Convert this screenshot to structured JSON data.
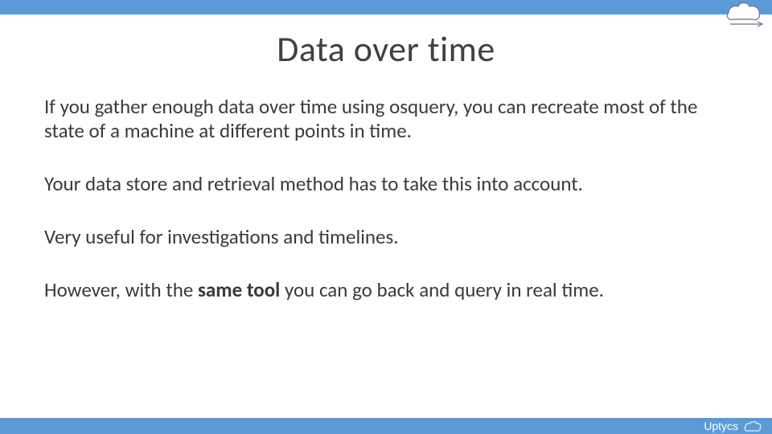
{
  "title": "Data over time",
  "paragraphs": {
    "p1": "If you gather enough data over time using osquery, you can recreate most of the state of a machine at different points in time.",
    "p2": "Your data store and retrieval method has to take this into account.",
    "p3": "Very useful for investigations and timelines.",
    "p4_before": "However, with the ",
    "p4_bold": "same tool",
    "p4_after": " you can go back and query in real time."
  },
  "brand": "Uptycs"
}
